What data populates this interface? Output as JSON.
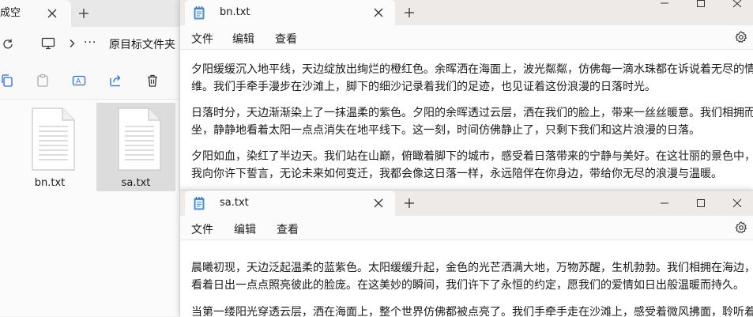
{
  "explorer": {
    "tab_title": "成空",
    "breadcrumb": "原目标文件夹",
    "more": "···",
    "files": [
      {
        "name": "bn.txt",
        "selected": false
      },
      {
        "name": "sa.txt",
        "selected": true
      }
    ]
  },
  "notepad_bn": {
    "tab_title": "bn.txt",
    "menu": [
      "文件",
      "编辑",
      "查看"
    ],
    "paragraphs": [
      [
        "夕阳缓缓沉入地平线，天边绽放出绚烂的橙红色。余晖洒在海面上，波光粼粼，仿佛每一滴水珠都在诉说着无尽的情",
        "维。我们手牵手漫步在沙滩上，脚下的细沙记录着我们的足迹，也见证着这份浪漫的日落时光。"
      ],
      [
        "日落时分，天边渐渐染上了一抹温柔的紫色。夕阳的余晖透过云层，洒在我们的脸上，带来一丝丝暖意。我们相拥而",
        "坐，静静地看着太阳一点点消失在地平线下。这一刻，时间仿佛静止了，只剩下我们和这片浪漫的日落。"
      ],
      [
        "夕阳如血，染红了半边天。我们站在山巅，俯瞰着脚下的城市，感受着日落带来的宁静与美好。在这壮丽的景色中，",
        "我向你许下誓言，无论未来如何变迁，我都会像这日落一样，永远陪伴在你身边，带给你无尽的浪漫与温暖。"
      ]
    ]
  },
  "notepad_sa": {
    "tab_title": "sa.txt",
    "menu": [
      "文件",
      "编辑",
      "查看"
    ],
    "paragraphs": [
      [
        "晨曦初现，天边泛起温柔的蓝紫色。太阳缓缓升起，金色的光芒洒满大地，万物苏醒，生机勃勃。我们相拥在海边，",
        "看着日出一点点照亮彼此的脸庞。在这美妙的瞬间，我们许下了永恒的约定，愿我们的爱情如日出般温暖而持久。"
      ],
      [
        "当第一缕阳光穿透云层，洒在海面上，整个世界仿佛都被点亮了。我们手牵手走在沙滩上，感受着微风拂面，聆听着"
      ]
    ]
  }
}
